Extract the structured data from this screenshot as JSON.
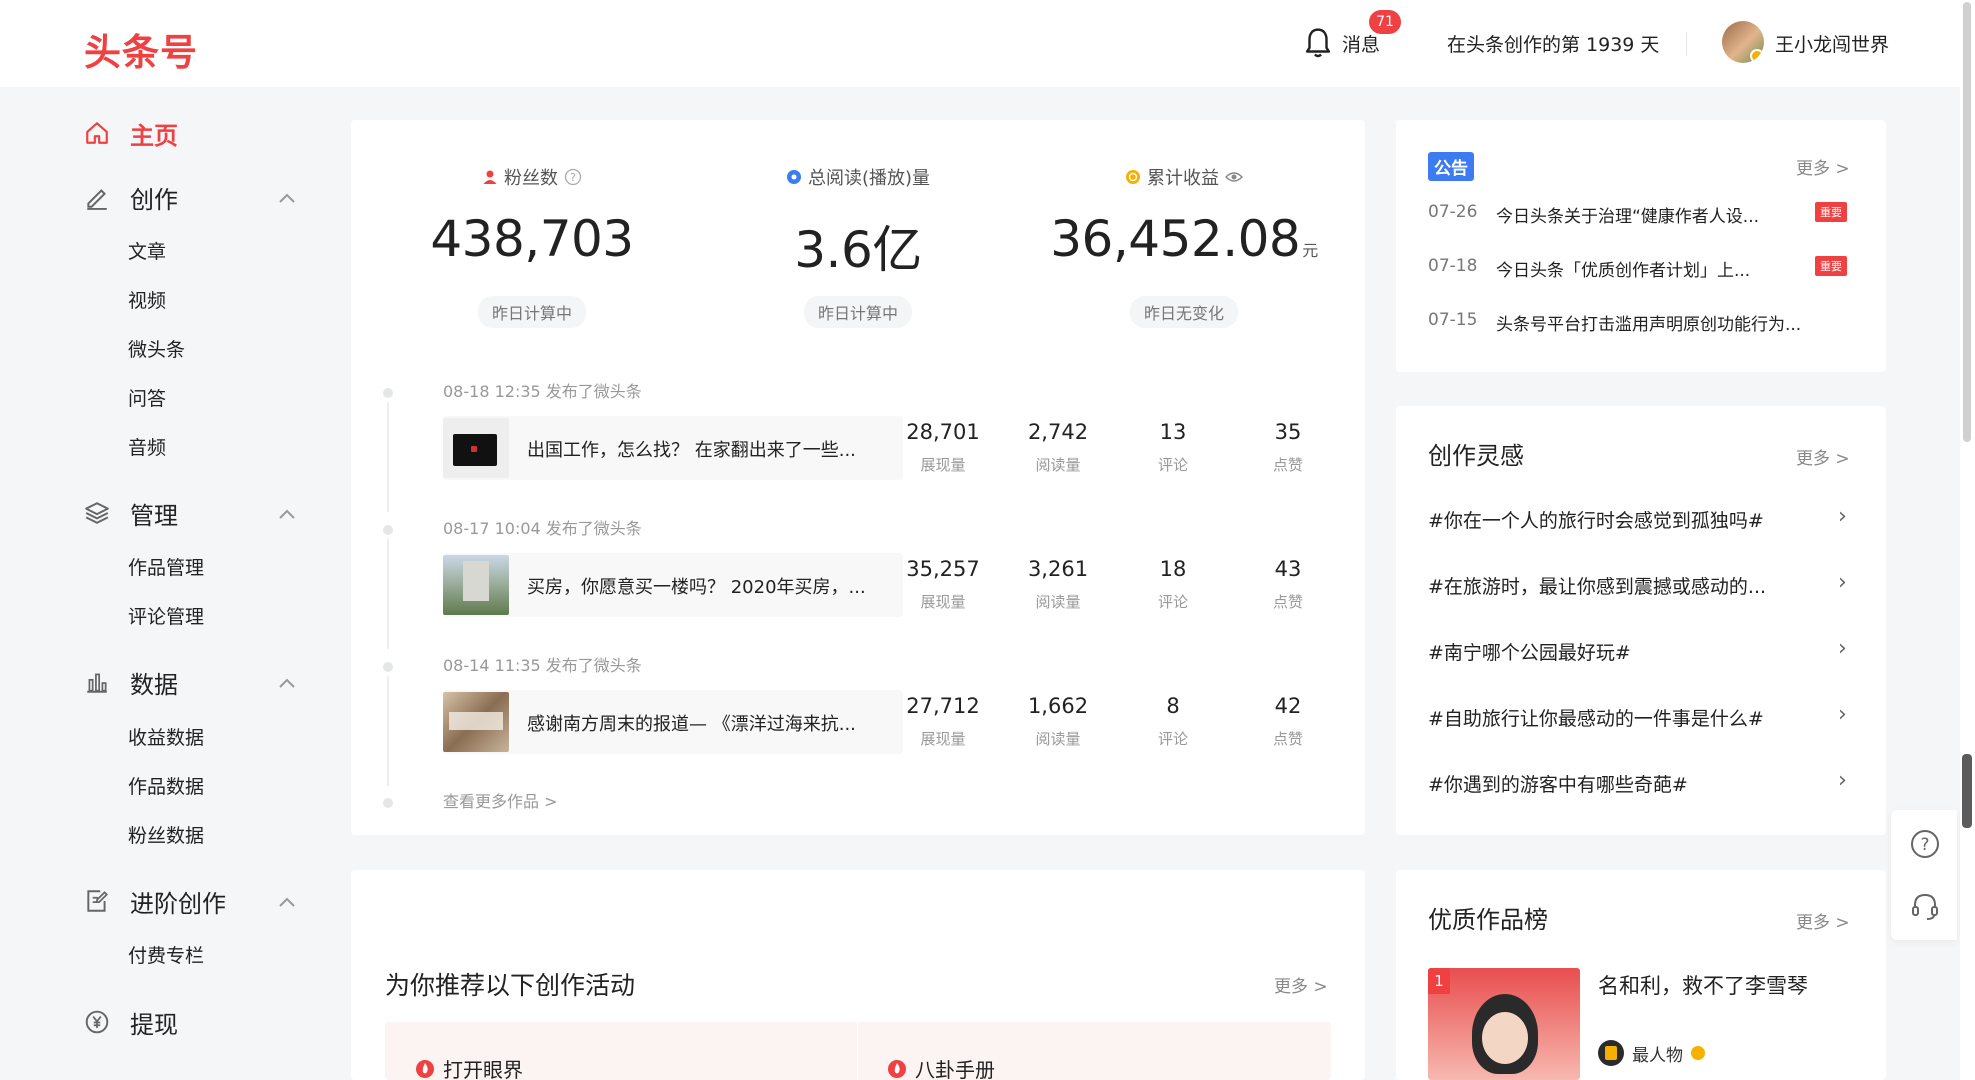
{
  "header": {
    "logo": "头条号",
    "messages_label": "消息",
    "messages_badge": "71",
    "days_text": "在头条创作的第 1939 天",
    "username": "王小龙闯世界"
  },
  "sidebar": {
    "home": "主页",
    "create": {
      "label": "创作",
      "items": [
        "文章",
        "视频",
        "微头条",
        "问答",
        "音频"
      ]
    },
    "manage": {
      "label": "管理",
      "items": [
        "作品管理",
        "评论管理"
      ]
    },
    "data": {
      "label": "数据",
      "items": [
        "收益数据",
        "作品数据",
        "粉丝数据"
      ]
    },
    "advanced": {
      "label": "进阶创作",
      "items": [
        "付费专栏"
      ]
    },
    "withdraw": "提现"
  },
  "stats": [
    {
      "label": "粉丝数",
      "value": "438,703",
      "note": "昨日计算中",
      "color": "#f04142"
    },
    {
      "label": "总阅读(播放)量",
      "value": "3.6亿",
      "note": "昨日计算中",
      "color": "#3c7cf0"
    },
    {
      "label": "累计收益",
      "value": "36,452.08",
      "unit": "元",
      "note": "昨日无变化",
      "color": "#f5b100"
    }
  ],
  "recent_posts": {
    "items": [
      {
        "meta": "08-18 12:35  发布了微头条",
        "title": "出国工作，怎么找？ 在家翻出来了一些...",
        "shows": "28,701",
        "shows_label": "展现量",
        "reads": "2,742",
        "reads_label": "阅读量",
        "comments": "13",
        "comments_label": "评论",
        "likes": "35",
        "likes_label": "点赞"
      },
      {
        "meta": "08-17 10:04  发布了微头条",
        "title": "买房，你愿意买一楼吗？ 2020年买房，...",
        "shows": "35,257",
        "shows_label": "展现量",
        "reads": "3,261",
        "reads_label": "阅读量",
        "comments": "18",
        "comments_label": "评论",
        "likes": "43",
        "likes_label": "点赞"
      },
      {
        "meta": "08-14 11:35  发布了微头条",
        "title": "感谢南方周末的报道— 《漂洋过海来抗...",
        "shows": "27,712",
        "shows_label": "展现量",
        "reads": "1,662",
        "reads_label": "阅读量",
        "comments": "8",
        "comments_label": "评论",
        "likes": "42",
        "likes_label": "点赞"
      }
    ],
    "more": "查看更多作品 >"
  },
  "activities": {
    "title": "为你推荐以下创作活动",
    "more": "更多 >",
    "tabs": [
      "打开眼界",
      "八卦手册"
    ]
  },
  "announcements": {
    "badge": "公告",
    "more": "更多 >",
    "items": [
      {
        "date": "07-26",
        "title": "今日头条关于治理“健康作者人设...",
        "tag": "重要"
      },
      {
        "date": "07-18",
        "title": "今日头条「优质创作者计划」上...",
        "tag": "重要"
      },
      {
        "date": "07-15",
        "title": "头条号平台打击滥用声明原创功能行为..."
      }
    ]
  },
  "inspiration": {
    "title": "创作灵感",
    "more": "更多 >",
    "topics": [
      "#你在一个人的旅行时会感觉到孤独吗#",
      "#在旅游时，最让你感到震撼或感动的...",
      "#南宁哪个公园最好玩#",
      "#自助旅行让你最感动的一件事是什么#",
      "#你遇到的游客中有哪些奇葩#"
    ]
  },
  "ranking": {
    "title": "优质作品榜",
    "more": "更多 >",
    "item": {
      "rank": "1",
      "title": "名和利，救不了李雪琴",
      "author": "最人物"
    }
  },
  "colors": {
    "accent": "#f04142",
    "blue": "#3c7cf0",
    "gold": "#f5b100"
  }
}
